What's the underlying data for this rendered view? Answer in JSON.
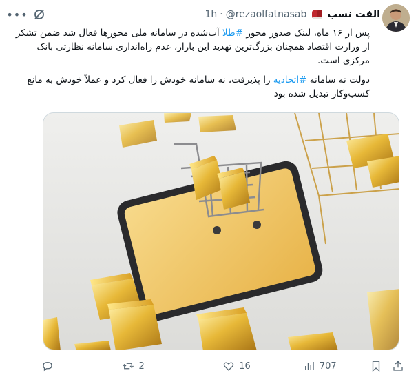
{
  "tweet": {
    "display_name": "رضا الفت نسب",
    "handle": "@rezaolfatnasab",
    "separator": "·",
    "time": "1h",
    "body_line1_pre": "پس از ۱۶ ماه، لینک صدور مجوز ",
    "hashtag1": "#طلا",
    "body_line1_post": " آب‌شده در سامانه ملی مجوزها فعال شد ضمن تشکر از وزارت اقتصاد همچنان بزرگ‌ترین تهدید این بازار، عدم راه‌اندازی سامانه نظارتی بانک مرکزی است.",
    "body_line2_pre": "دولت نه سامانه ",
    "hashtag2": "#اتحادیه",
    "body_line2_post": " را پذیرفت، نه سامانه خودش را فعال کرد و عملاً خودش به مانع کسب‌وکار تبدیل شده بود",
    "media_alt_icon": "gold-bars-in-shopping-cart-on-phone",
    "counts": {
      "replies": "",
      "retweets": "2",
      "likes": "16",
      "views": "707"
    }
  },
  "colors": {
    "accent": "#1d9bf0",
    "text": "#0f1419",
    "muted": "#536471",
    "heart": "#c0272d"
  },
  "icons": [
    "more-icon",
    "grok-icon",
    "boxing-glove-icon",
    "reply-icon",
    "retweet-icon",
    "like-icon",
    "views-icon",
    "bookmark-icon",
    "share-icon"
  ]
}
